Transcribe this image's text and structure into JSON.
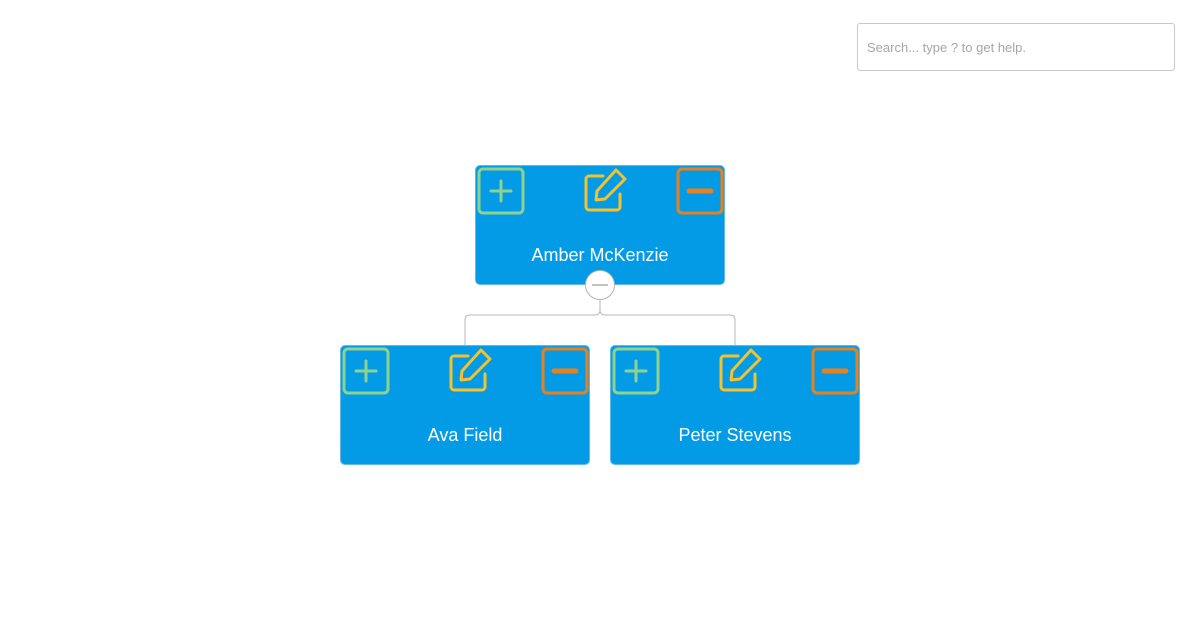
{
  "search": {
    "placeholder": "Search... type ? to get help."
  },
  "colors": {
    "node_fill": "#039be5",
    "node_border": "#5fb8e6",
    "add_button": "#8fd18f",
    "edit_button": "#f5c12e",
    "remove_button": "#e9801f",
    "connector": "#b8b8b8"
  },
  "icons": {
    "add": "plus-square-icon",
    "edit": "edit-pencil-icon",
    "remove": "minus-square-icon",
    "collapse": "collapse-minus-icon"
  },
  "org_chart": {
    "root": {
      "name": "Amber McKenzie",
      "children": [
        {
          "name": "Ava Field"
        },
        {
          "name": "Peter Stevens"
        }
      ]
    }
  }
}
